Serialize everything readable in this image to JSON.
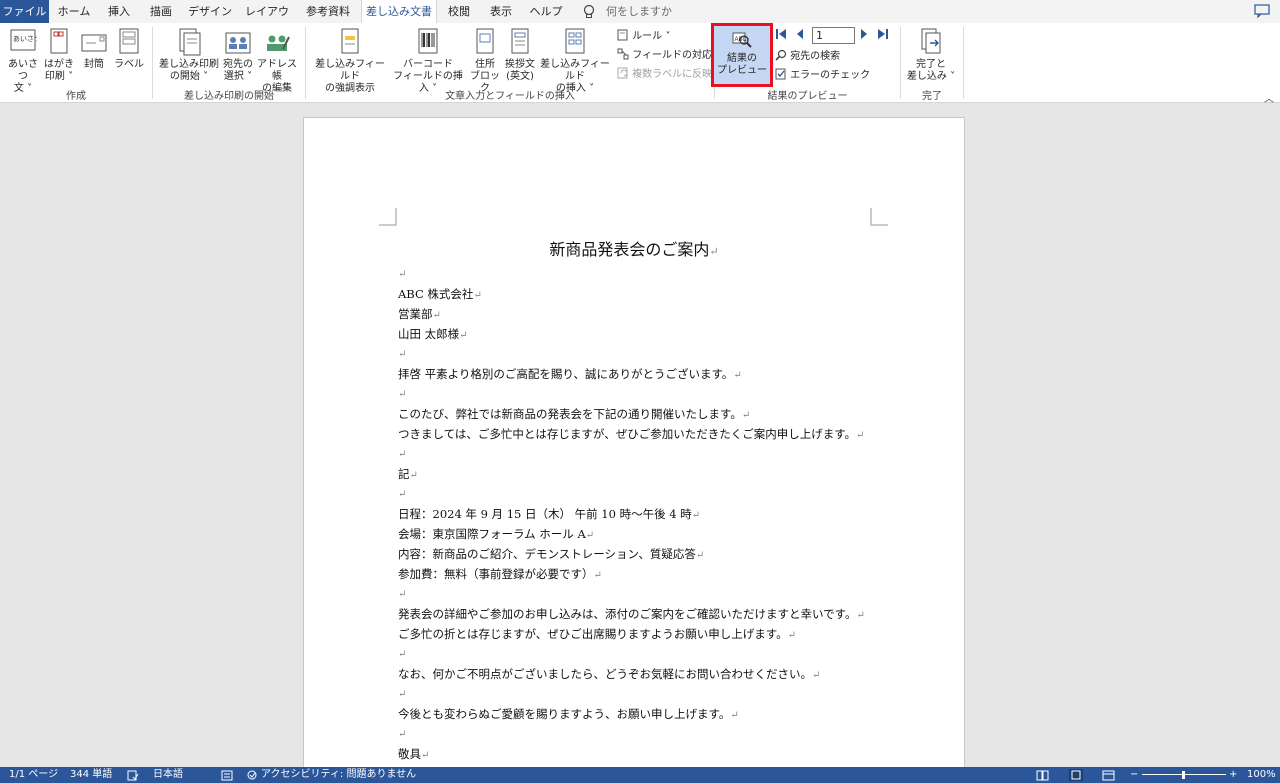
{
  "tabs": [
    "ファイル",
    "ホーム",
    "挿入",
    "描画",
    "デザイン",
    "レイアウト",
    "参考資料",
    "差し込み文書",
    "校閲",
    "表示",
    "ヘルプ"
  ],
  "tell_me": "何をしますか",
  "ribbon": {
    "create": {
      "label": "作成",
      "greeting": [
        "あいさつ",
        "文 ˅"
      ],
      "postcard": [
        "はがき",
        "印刷 ˅"
      ],
      "envelope": "封筒",
      "labels": "ラベル"
    },
    "start": {
      "label": "差し込み印刷の開始",
      "start_merge": [
        "差し込み印刷",
        "の開始 ˅"
      ],
      "select_recipients": [
        "宛先の",
        "選択 ˅"
      ],
      "edit_list": [
        "アドレス帳",
        "の編集"
      ]
    },
    "write": {
      "label": "文章入力とフィールドの挿入",
      "highlight": [
        "差し込みフィールド",
        "の強調表示"
      ],
      "barcode": [
        "バーコード",
        "フィールドの挿入 ˅"
      ],
      "address_block": [
        "住所",
        "ブロック"
      ],
      "greeting_line": [
        "挨拶文",
        "(英文)"
      ],
      "insert_field": [
        "差し込みフィールド",
        "の挿入 ˅"
      ],
      "rules": "ルール ˅",
      "match_fields": "フィールドの対応",
      "update_labels": "複数ラベルに反映"
    },
    "preview": {
      "label": "結果のプレビュー",
      "preview_results": [
        "結果の",
        "プレビュー"
      ],
      "record": "1",
      "find_recipient": "宛先の検索",
      "check_errors": "エラーのチェック"
    },
    "finish": {
      "label": "完了",
      "finish_merge": [
        "完了と",
        "差し込み ˅"
      ]
    }
  },
  "document": {
    "title": "新商品発表会のご案内",
    "lines": [
      "",
      "ABC 株式会社",
      "営業部",
      "山田 太郎様",
      "",
      "拝啓 平素より格別のご高配を賜り、誠にありがとうございます。",
      "",
      "このたび、弊社では新商品の発表会を下記の通り開催いたします。",
      "つきましては、ご多忙中とは存じますが、ぜひご参加いただきたくご案内申し上げます。",
      "",
      "記",
      "",
      "日程：2024 年 9 月 15 日（木） 午前 10 時〜午後 4 時",
      "会場：東京国際フォーラム ホール A",
      "内容：新商品のご紹介、デモンストレーション、質疑応答",
      "参加費：無料（事前登録が必要です）",
      "",
      "発表会の詳細やご参加のお申し込みは、添付のご案内をご確認いただけますと幸いです。",
      "ご多忙の折とは存じますが、ぜひご出席賜りますようお願い申し上げます。",
      "",
      "なお、何かご不明点がございましたら、どうぞお気軽にお問い合わせください。",
      "",
      "今後とも変わらぬご愛顧を賜りますよう、お願い申し上げます。",
      "",
      "敬具"
    ]
  },
  "status": {
    "page": "1/1 ページ",
    "words": "344 単語",
    "language": "日本語",
    "accessibility": "アクセシビリティ: 問題ありません",
    "zoom": "100%"
  }
}
